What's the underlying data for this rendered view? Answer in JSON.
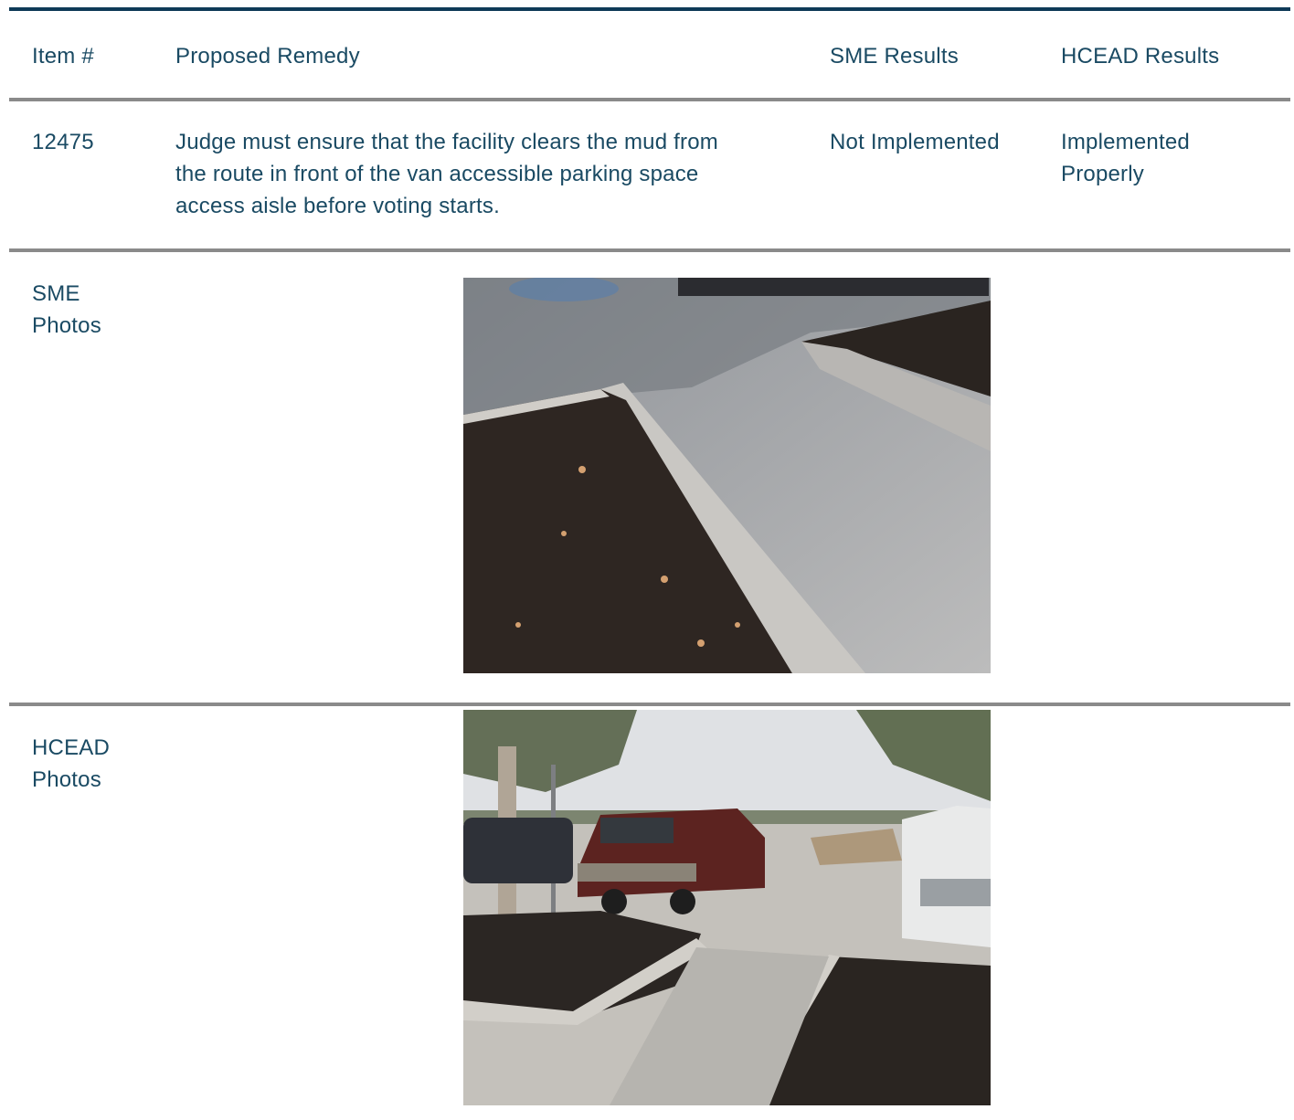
{
  "table": {
    "headers": {
      "item": "Item #",
      "remedy": "Proposed Remedy",
      "sme": "SME Results",
      "hcead": "HCEAD Results"
    },
    "row": {
      "item": "12475",
      "remedy_lines": [
        "Judge must ensure that the facility clears the mud from",
        "the route in front of the van accessible parking space",
        "access aisle before voting starts."
      ],
      "sme": "Not Implemented",
      "hcead_lines": [
        "Implemented",
        "Properly"
      ]
    }
  },
  "sme_photos": {
    "label_lines": [
      "SME",
      "Photos"
    ]
  },
  "hcead_photos": {
    "label_lines": [
      "HCEAD",
      "Photos"
    ]
  },
  "colors": {
    "text": "#1a4a63",
    "top_rule": "#0e3a57",
    "row_rule": "#8a8a8a"
  }
}
